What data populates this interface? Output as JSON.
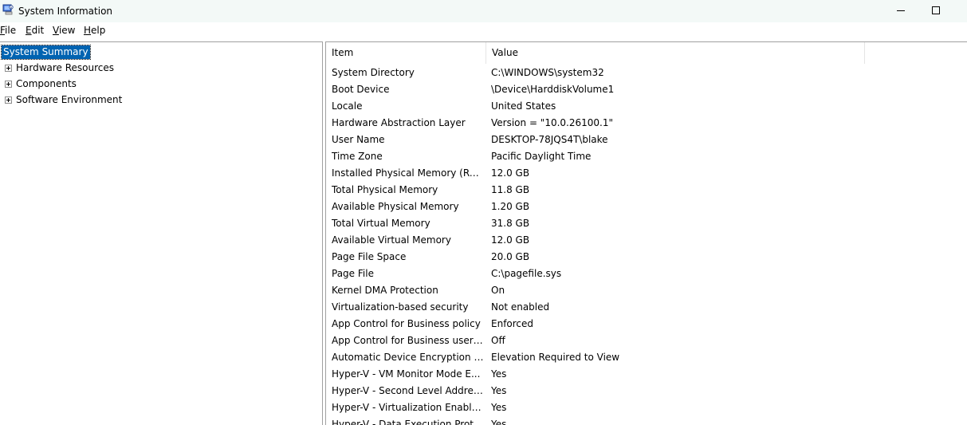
{
  "window": {
    "title": "System Information",
    "icon": "system-information-icon"
  },
  "menu": {
    "items": [
      "File",
      "Edit",
      "View",
      "Help"
    ]
  },
  "tree": {
    "root": "System Summary",
    "children": [
      "Hardware Resources",
      "Components",
      "Software Environment"
    ]
  },
  "table": {
    "columns": [
      "Item",
      "Value"
    ],
    "rows": [
      {
        "item": "System Directory",
        "value": "C:\\WINDOWS\\system32"
      },
      {
        "item": "Boot Device",
        "value": "\\Device\\HarddiskVolume1"
      },
      {
        "item": "Locale",
        "value": "United States"
      },
      {
        "item": "Hardware Abstraction Layer",
        "value": "Version = \"10.0.26100.1\""
      },
      {
        "item": "User Name",
        "value": "DESKTOP-78JQS4T\\blake"
      },
      {
        "item": "Time Zone",
        "value": "Pacific Daylight Time"
      },
      {
        "item": "Installed Physical Memory (RAM)",
        "value": "12.0 GB"
      },
      {
        "item": "Total Physical Memory",
        "value": "11.8 GB"
      },
      {
        "item": "Available Physical Memory",
        "value": "1.20 GB"
      },
      {
        "item": "Total Virtual Memory",
        "value": "31.8 GB"
      },
      {
        "item": "Available Virtual Memory",
        "value": "12.0 GB"
      },
      {
        "item": "Page File Space",
        "value": "20.0 GB"
      },
      {
        "item": "Page File",
        "value": "C:\\pagefile.sys"
      },
      {
        "item": "Kernel DMA Protection",
        "value": "On"
      },
      {
        "item": "Virtualization-based security",
        "value": "Not enabled"
      },
      {
        "item": "App Control for Business policy",
        "value": "Enforced"
      },
      {
        "item": "App Control for Business user ...",
        "value": "Off"
      },
      {
        "item": "Automatic Device Encryption Su...",
        "value": "Elevation Required to View"
      },
      {
        "item": "Hyper-V - VM Monitor Mode E...",
        "value": "Yes"
      },
      {
        "item": "Hyper-V - Second Level Addres...",
        "value": "Yes"
      },
      {
        "item": "Hyper-V - Virtualization Enable...",
        "value": "Yes"
      },
      {
        "item": "Hyper-V - Data Execution Prote...",
        "value": "Yes"
      }
    ]
  },
  "colors": {
    "titlebar": "#f3f9f7",
    "selection": "#0063b1"
  }
}
